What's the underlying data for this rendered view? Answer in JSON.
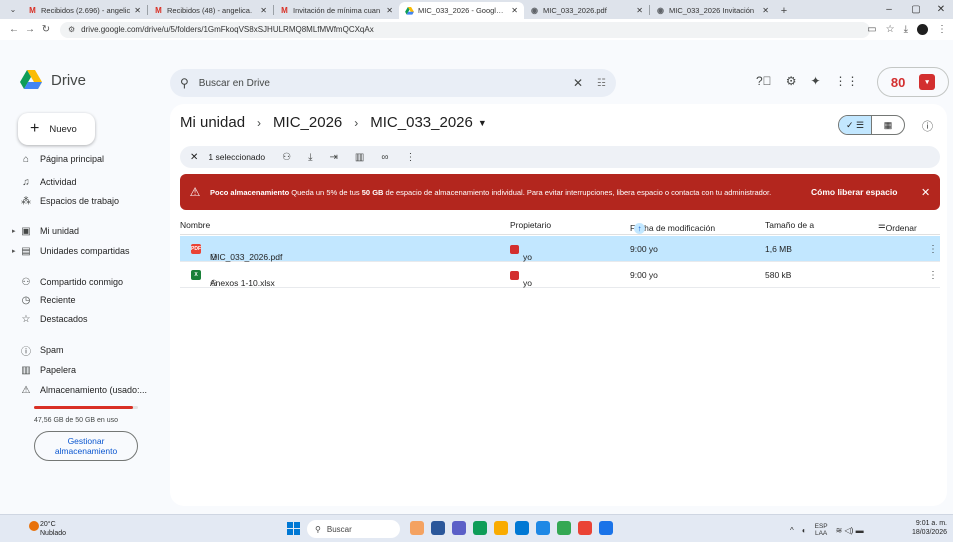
{
  "browser": {
    "tabs": [
      {
        "title": "Recibidos (2.696) - angelic",
        "icon": "gmail-icon",
        "active": false
      },
      {
        "title": "Recibidos (48) - angelica.",
        "icon": "gmail-icon",
        "active": false
      },
      {
        "title": "Invitación de mínima cuan",
        "icon": "gmail-icon",
        "active": false
      },
      {
        "title": "MIC_033_2026 - Google D",
        "icon": "drive-icon",
        "active": true
      },
      {
        "title": "MIC_033_2026.pdf",
        "icon": "globe-icon",
        "active": false
      },
      {
        "title": "MIC_033_2026 Invitación",
        "icon": "globe-icon",
        "active": false
      }
    ],
    "url": "drive.google.com/drive/u/5/folders/1GmFkoqVS8xSJHULRMQ8MLfMWfmQCXqAx"
  },
  "header": {
    "app_name": "Drive",
    "search_placeholder": "Buscar en Drive",
    "brand_logo_text": "80"
  },
  "sidebar": {
    "new_label": "Nuevo",
    "items": [
      {
        "label": "Página principal",
        "icon": "home-icon"
      },
      {
        "label": "Actividad",
        "icon": "bell-icon"
      },
      {
        "label": "Espacios de trabajo",
        "icon": "workspaces-icon"
      },
      {
        "label": "Mi unidad",
        "icon": "my-drive-icon"
      },
      {
        "label": "Unidades compartidas",
        "icon": "shared-drives-icon"
      },
      {
        "label": "Compartido conmigo",
        "icon": "people-icon"
      },
      {
        "label": "Reciente",
        "icon": "clock-icon"
      },
      {
        "label": "Destacados",
        "icon": "star-icon"
      },
      {
        "label": "Spam",
        "icon": "spam-icon"
      },
      {
        "label": "Papelera",
        "icon": "trash-icon"
      },
      {
        "label": "Almacenamiento (usado:...",
        "icon": "storage-warning-icon"
      }
    ],
    "quota_text": "47,56 GB de 50 GB en uso",
    "quota_fraction": 0.951,
    "manage_label_1": "Gestionar",
    "manage_label_2": "almacenamiento"
  },
  "main": {
    "breadcrumb": [
      "Mi unidad",
      "MIC_2026",
      "MIC_033_2026"
    ],
    "selection_label": "1 seleccionado",
    "banner": {
      "title": "Poco almacenamiento",
      "text_a": " Queda un 5% de tus ",
      "text_bold": "50 GB",
      "text_b": " de espacio de almacenamiento individual. Para evitar interrupciones, libera espacio o contacta con tu administrador.",
      "link": "Cómo liberar espacio"
    },
    "columns": {
      "name": "Nombre",
      "owner": "Propietario",
      "modified": "Fecha de modificación",
      "size": "Tamaño de a",
      "sort": "Ordenar"
    },
    "files": [
      {
        "name": "MIC_033_2026.pdf",
        "type": "pdf",
        "owner": "yo",
        "modified": "9:00 yo",
        "size": "1,6 MB",
        "selected": true
      },
      {
        "name": "Anexos 1-10.xlsx",
        "type": "xlsx",
        "owner": "yo",
        "modified": "9:00 yo",
        "size": "580 kB",
        "selected": false
      }
    ]
  },
  "taskbar": {
    "temp": "20°C",
    "weather": "Nublado",
    "search_label": "Buscar",
    "lang_1": "ESP",
    "lang_2": "LAA",
    "time": "9:01 a. m.",
    "date": "18/03/2026"
  }
}
